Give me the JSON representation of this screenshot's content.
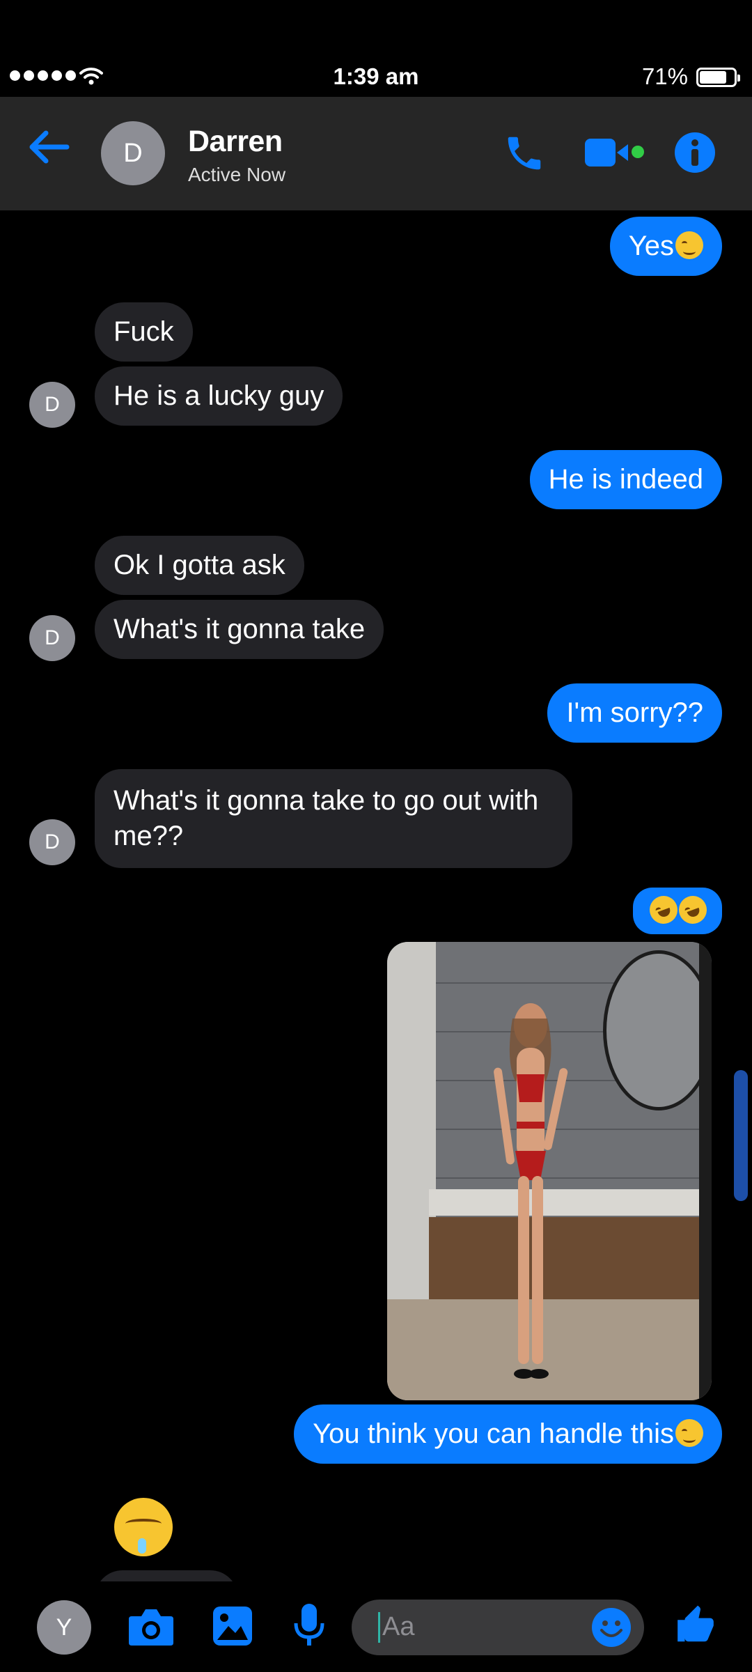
{
  "status_bar": {
    "time": "1:39 am",
    "battery": "71%"
  },
  "header": {
    "avatar_initial": "D",
    "name": "Darren",
    "status": "Active Now"
  },
  "messages": [
    {
      "text": "Yes",
      "direction": "out",
      "emoji": "winking-face"
    },
    {
      "text": "Fuck",
      "direction": "in"
    },
    {
      "text": "He is a lucky guy",
      "direction": "in"
    },
    {
      "text": "He is indeed",
      "direction": "out"
    },
    {
      "text": "Ok I gotta ask",
      "direction": "in"
    },
    {
      "text": "What's it gonna take",
      "direction": "in"
    },
    {
      "text": "I'm sorry??",
      "direction": "out"
    },
    {
      "text": "What's it gonna take to go out with me??",
      "direction": "in"
    },
    {
      "text": "",
      "direction": "out",
      "emoji": "rolling-on-floor-laughing x2"
    },
    {
      "text": "",
      "direction": "out",
      "type": "photo"
    },
    {
      "text": "You think you can handle this",
      "direction": "out",
      "emoji": "winking-face"
    },
    {
      "text": "",
      "direction": "in",
      "emoji": "drooling-face"
    }
  ],
  "chat_avatar_initial": "D",
  "composer": {
    "my_initial": "Y",
    "placeholder": "Aa"
  },
  "colors": {
    "accent": "#0a7cff",
    "incoming_bubble": "#232327",
    "header_bg": "#262626",
    "online_dot": "#31cc46"
  }
}
